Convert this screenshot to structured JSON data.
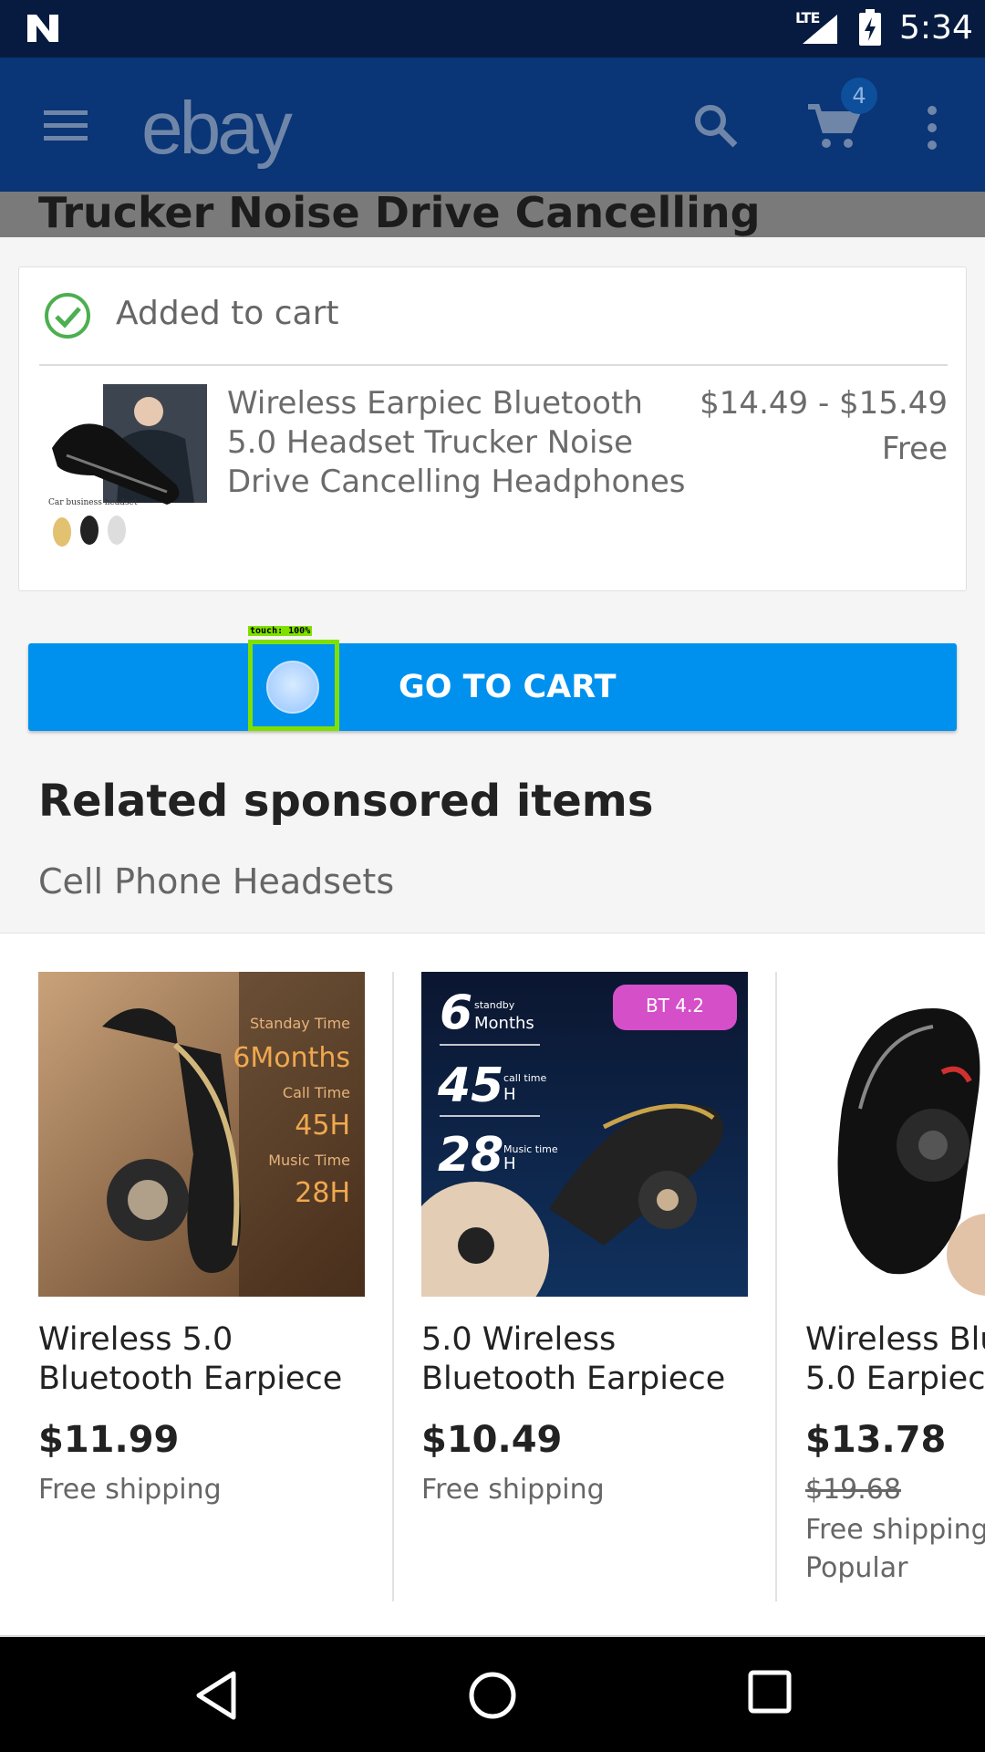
{
  "status_bar": {
    "network": "LTE",
    "time": "5:34"
  },
  "app_bar": {
    "logo": "ebay",
    "cart_count": "4"
  },
  "background_title": "Trucker Noise Drive Cancelling",
  "added_card": {
    "status": "Added to cart",
    "item_title": "Wireless Earpiec Bluetooth 5.0 Headset Trucker Noise Drive Cancelling Headphones",
    "price": "$14.49 - $15.49",
    "shipping": "Free"
  },
  "go_to_cart_label": "GO TO CART",
  "touch_overlay": "touch: 100%",
  "related": {
    "heading": "Related sponsored items",
    "category": "Cell Phone Headsets",
    "items": [
      {
        "title_line1": "Wireless 5.0",
        "title_line2": "Bluetooth Earpiece",
        "price": "$11.99",
        "shipping": "Free shipping"
      },
      {
        "title_line1": "5.0 Wireless",
        "title_line2": "Bluetooth Earpiece",
        "price": "$10.49",
        "shipping": "Free shipping"
      },
      {
        "title_line1": "Wireless Blu",
        "title_line2": "5.0 Earpiece",
        "price": "$13.78",
        "original_price": "$19.68",
        "shipping": "Free shipping",
        "tag": "Popular"
      }
    ],
    "image_text": {
      "p1": [
        "Standay Time",
        "6Months",
        "Call Time",
        "45H",
        "Music Time",
        "28H"
      ],
      "p2": [
        "6",
        "standby",
        "Months",
        "45",
        "call time",
        "H",
        "28",
        "Music time",
        "H",
        "BT 4.2"
      ]
    }
  },
  "icons": {
    "status": [
      "n-logo-icon",
      "signal-icon",
      "battery-charging-icon"
    ],
    "app_bar": [
      "menu-icon",
      "search-icon",
      "cart-icon",
      "more-vert-icon"
    ],
    "nav": [
      "back-icon",
      "home-icon",
      "recents-icon"
    ]
  },
  "colors": {
    "status_bar": "#061b3f",
    "app_bar": "#0a3576",
    "primary_button": "#0091ee",
    "success": "#4caf50",
    "touch_highlight": "#7fe000"
  }
}
